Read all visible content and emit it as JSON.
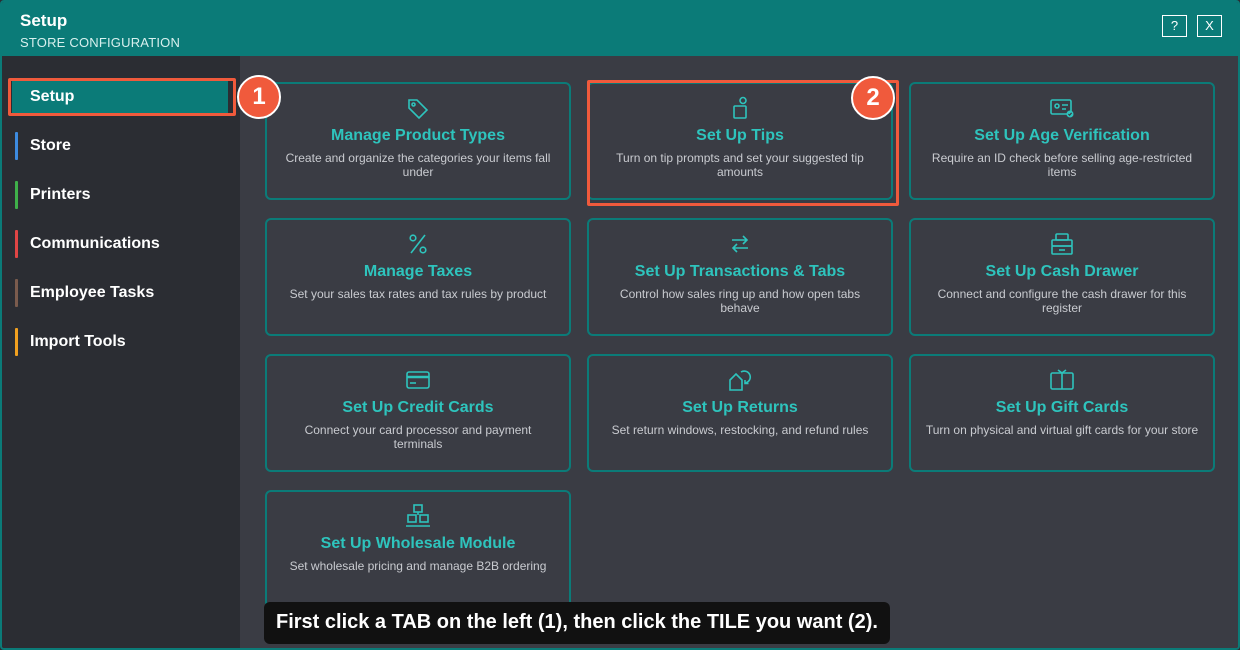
{
  "window": {
    "title": "Setup",
    "subtitle": "STORE CONFIGURATION",
    "help_label": "?",
    "close_label": "X"
  },
  "sidebar": {
    "items": [
      {
        "label": "Setup",
        "color": "#0b7b78",
        "active": true
      },
      {
        "label": "Store",
        "color": "#3d8be0"
      },
      {
        "label": "Printers",
        "color": "#3fb04a"
      },
      {
        "label": "Communications",
        "color": "#e04545"
      },
      {
        "label": "Employee Tasks",
        "color": "#7a5b4d"
      },
      {
        "label": "Import Tools",
        "color": "#f0a020"
      }
    ]
  },
  "tiles": [
    {
      "title": "Manage Product Types",
      "desc": "Create and organize the categories your items fall under",
      "icon": "tag-icon"
    },
    {
      "title": "Set Up Tips",
      "desc": "Turn on tip prompts and set your suggested tip amounts",
      "icon": "tip-jar-icon"
    },
    {
      "title": "Set Up Age Verification",
      "desc": "Require an ID check before selling age-restricted items",
      "icon": "id-card-icon"
    },
    {
      "title": "Manage Taxes",
      "desc": "Set your sales tax rates and tax rules by product",
      "icon": "percent-icon"
    },
    {
      "title": "Set Up Transactions & Tabs",
      "desc": "Control how sales ring up and how open tabs behave",
      "icon": "swap-arrows-icon"
    },
    {
      "title": "Set Up Cash Drawer",
      "desc": "Connect and configure the cash drawer for this register",
      "icon": "cash-drawer-icon"
    },
    {
      "title": "Set Up Credit Cards",
      "desc": "Connect your card processor and payment terminals",
      "icon": "credit-card-icon"
    },
    {
      "title": "Set Up Returns",
      "desc": "Set return windows, restocking, and refund rules",
      "icon": "return-icon"
    },
    {
      "title": "Set Up Gift Cards",
      "desc": "Turn on physical and virtual gift cards for your store",
      "icon": "gift-card-icon"
    },
    {
      "title": "Set Up Wholesale Module",
      "desc": "Set wholesale pricing and manage B2B ordering",
      "icon": "boxes-icon"
    }
  ],
  "annotations": {
    "badge_1": "1",
    "badge_2": "2",
    "caption": "First click a TAB on the left (1), then click the TILE you want (2).",
    "highlight_color": "#f05a3c"
  }
}
